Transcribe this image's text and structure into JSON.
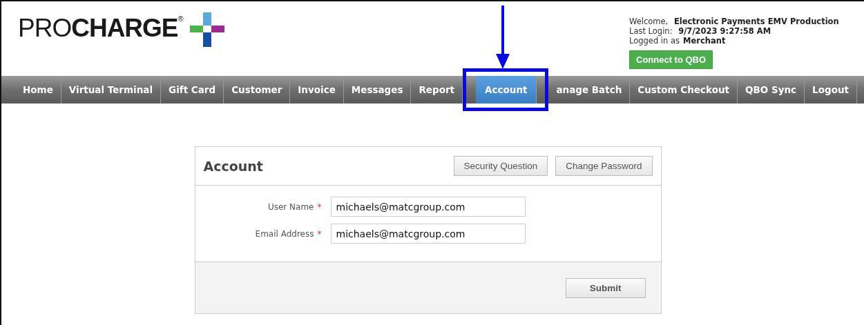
{
  "logo": {
    "light": "PRO",
    "bold": "CHARGE",
    "mark": "®"
  },
  "user_info": {
    "welcome_label": "Welcome,",
    "welcome_value": "Electronic Payments EMV Production",
    "login_label": "Last Login:",
    "login_value": "9/7/2023 9:27:58 AM",
    "role_label": "Logged in as",
    "role_value": "Merchant"
  },
  "connect_button": "Connect to QBO",
  "nav": [
    {
      "label": "Home",
      "selected": false,
      "highlighted": false
    },
    {
      "label": "Virtual Terminal",
      "selected": false,
      "highlighted": false
    },
    {
      "label": "Gift Card",
      "selected": false,
      "highlighted": false
    },
    {
      "label": "Customer",
      "selected": false,
      "highlighted": false
    },
    {
      "label": "Invoice",
      "selected": false,
      "highlighted": false
    },
    {
      "label": "Messages",
      "selected": false,
      "highlighted": false
    },
    {
      "label": "Report",
      "selected": false,
      "highlighted": false
    },
    {
      "label": "Account",
      "selected": true,
      "highlighted": true
    },
    {
      "label": "anage Batch",
      "selected": false,
      "highlighted": false
    },
    {
      "label": "Custom Checkout",
      "selected": false,
      "highlighted": false
    },
    {
      "label": "QBO Sync",
      "selected": false,
      "highlighted": false
    },
    {
      "label": "Logout",
      "selected": false,
      "highlighted": false
    }
  ],
  "panel": {
    "title": "Account",
    "buttons": [
      "Security Question",
      "Change Password"
    ],
    "fields": [
      {
        "label": "User Name",
        "required": true,
        "value": "michaels@matcgroup.com"
      },
      {
        "label": "Email Address",
        "required": true,
        "value": "michaels@matcgroup.com"
      }
    ],
    "required_mark": "*",
    "submit": "Submit"
  }
}
